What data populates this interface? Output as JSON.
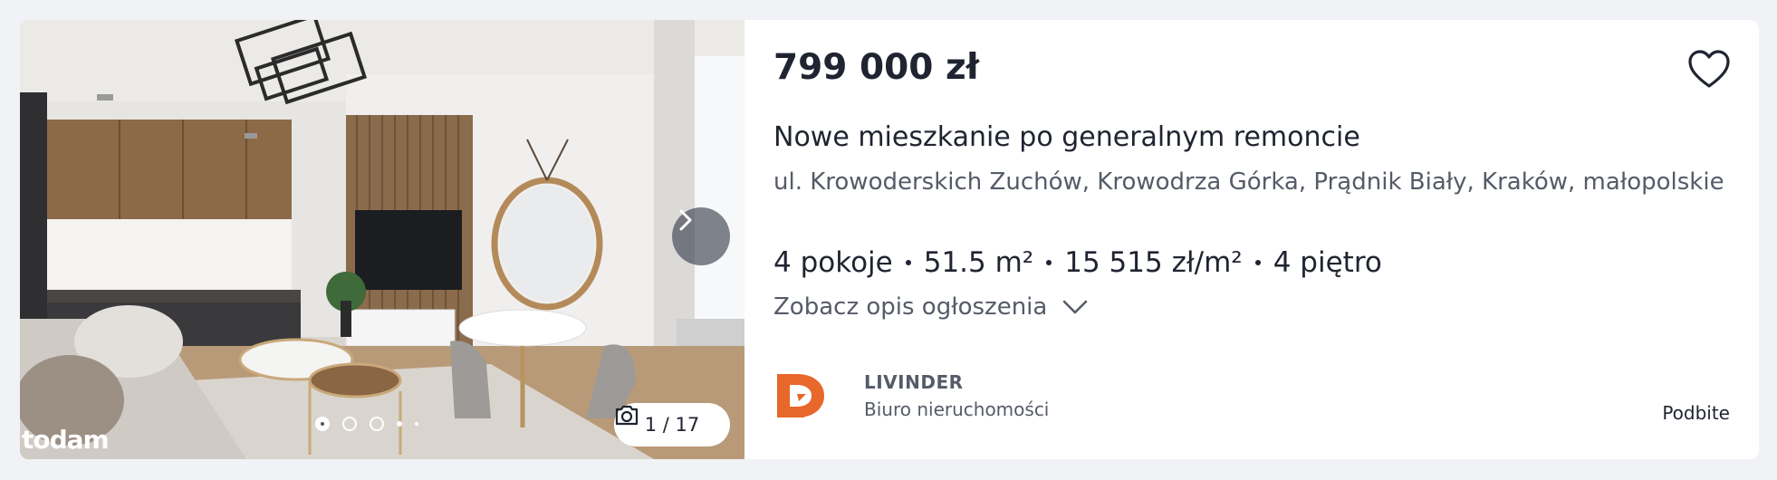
{
  "listing": {
    "price": "799 000 zł",
    "title": "Nowe mieszkanie po generalnym remoncie",
    "address": "ul. Krowoderskich Zuchów, Krowodrza Górka, Prądnik Biały, Kraków, małopolskie",
    "params": {
      "rooms": "4 pokoje",
      "area": "51.5 m²",
      "price_per_m2": "15 515 zł/m²",
      "floor": "4 piętro"
    },
    "description_link": "Zobacz opis ogłoszenia",
    "promoted_label": "Podbite"
  },
  "gallery": {
    "counter": "1 / 17",
    "watermark": "todam",
    "icons": {
      "next": "chevron-right-icon",
      "camera": "camera-icon"
    }
  },
  "agency": {
    "name": "LIVINDER",
    "type": "Biuro nieruchomości",
    "brand_color": "#e8672a"
  },
  "icons": {
    "favorite": "heart-icon",
    "expand": "chevron-down-icon"
  }
}
